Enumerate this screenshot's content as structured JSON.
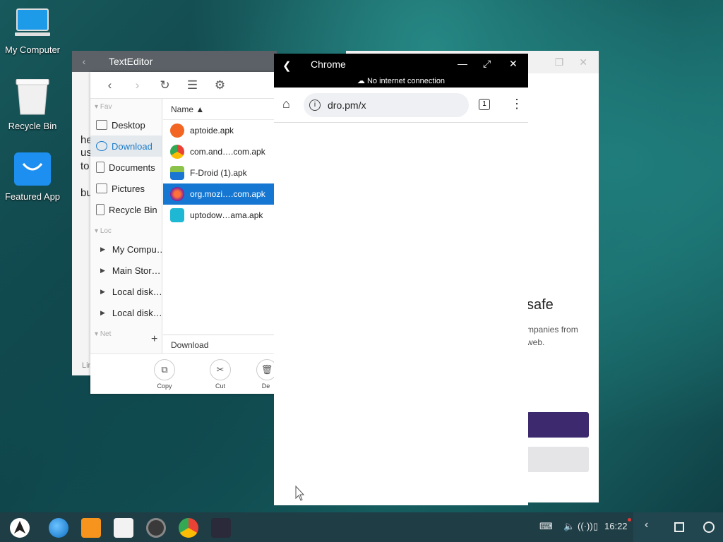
{
  "desktop": {
    "icons": [
      {
        "label": "My Computer"
      },
      {
        "label": "Recycle Bin"
      },
      {
        "label": "Featured App"
      }
    ]
  },
  "background_window": {
    "heading": "safe",
    "line1": "mpanies from",
    "line2": "web."
  },
  "text_editor": {
    "title": "TextEditor",
    "fragments": [
      "he",
      "us",
      "to",
      "bu"
    ],
    "status": "Lin"
  },
  "file_manager": {
    "sidebar": {
      "fav_label": "Fav",
      "fav_items": [
        {
          "label": "Desktop"
        },
        {
          "label": "Download"
        },
        {
          "label": "Documents"
        },
        {
          "label": "Pictures"
        },
        {
          "label": "Recycle Bin"
        }
      ],
      "loc_label": "Loc",
      "loc_items": [
        {
          "label": "My Compu…"
        },
        {
          "label": "Main Stor…"
        },
        {
          "label": "Local disk…"
        },
        {
          "label": "Local disk…"
        }
      ],
      "net_label": "Net",
      "add_label": "+"
    },
    "column_header": "Name ▲",
    "files": [
      {
        "name": "aptoide.apk",
        "color": "#f26522"
      },
      {
        "name": "com.and….com.apk",
        "color": "#4285f4"
      },
      {
        "name": "F-Droid (1).apk",
        "color": "#1976d2"
      },
      {
        "name": "org.mozi….com.apk",
        "color": "#7b1fa2"
      },
      {
        "name": "uptodow…ama.apk",
        "color": "#1fb8d4"
      }
    ],
    "breadcrumb": "Download",
    "actions": [
      {
        "label": "Copy"
      },
      {
        "label": "Cut"
      },
      {
        "label": "De"
      }
    ]
  },
  "chrome": {
    "title": "Chrome",
    "network_status": "No internet connection",
    "url": "dro.pm/x",
    "tab_count": "1"
  },
  "taskbar": {
    "time": "16:22"
  }
}
